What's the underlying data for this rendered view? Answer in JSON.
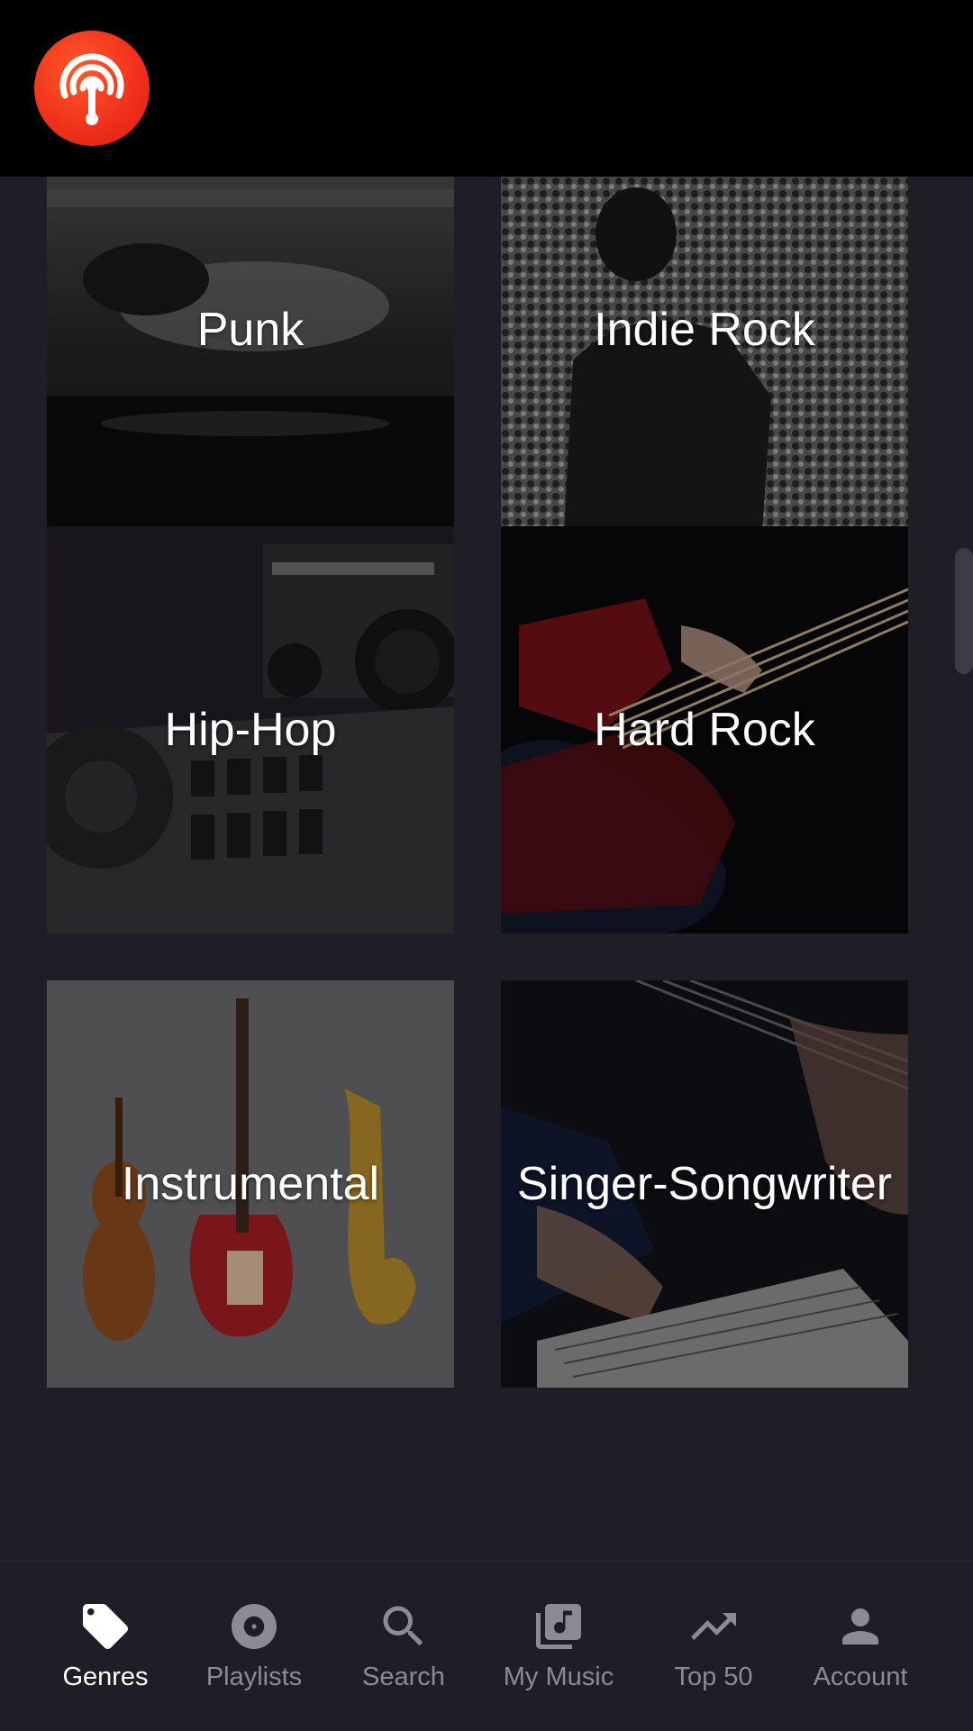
{
  "app": {
    "logo_icon": "broadcast-antenna-icon",
    "accent_color": "#f0321c"
  },
  "genres": [
    {
      "label": "Punk"
    },
    {
      "label": "Indie Rock"
    },
    {
      "label": "Hip-Hop"
    },
    {
      "label": "Hard Rock"
    },
    {
      "label": "Instrumental"
    },
    {
      "label": "Singer-Songwriter"
    }
  ],
  "nav": {
    "items": [
      {
        "label": "Genres",
        "icon": "tag-icon",
        "active": true
      },
      {
        "label": "Playlists",
        "icon": "disc-icon",
        "active": false
      },
      {
        "label": "Search",
        "icon": "search-icon",
        "active": false
      },
      {
        "label": "My Music",
        "icon": "music-library-icon",
        "active": false
      },
      {
        "label": "Top 50",
        "icon": "trending-up-icon",
        "active": false
      },
      {
        "label": "Account",
        "icon": "person-icon",
        "active": false
      }
    ]
  }
}
